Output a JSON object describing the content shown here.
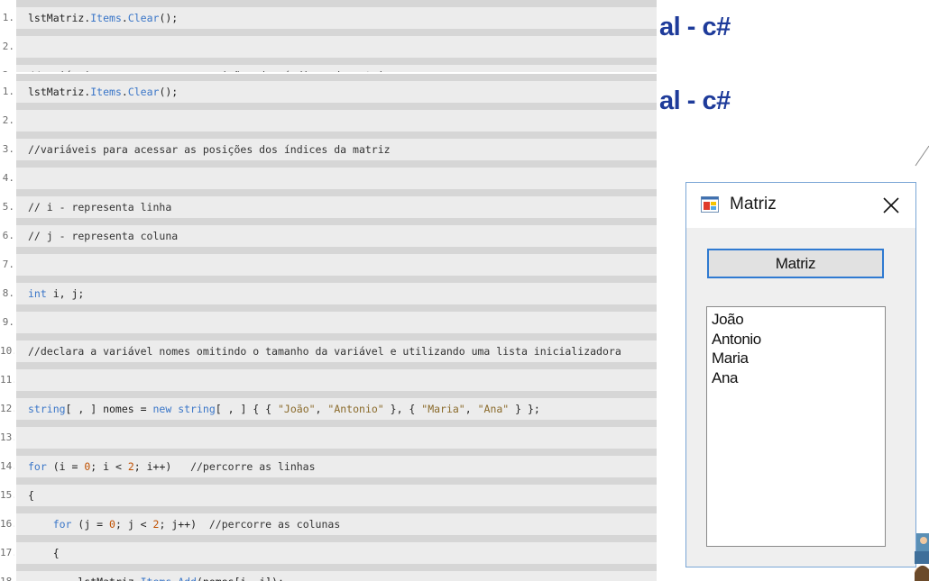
{
  "slide": {
    "title_top": "al - c#",
    "title_main": "al - c#"
  },
  "code_top": {
    "lines": [
      {
        "n": "1.",
        "html": "lstMatriz.<span class=\"kw\">Items</span>.<span class=\"kw\">Clear</span>();"
      },
      {
        "n": "2.",
        "html": ""
      },
      {
        "n": "3.",
        "html": "<span class=\"cm\">//variáveis para acessar as posições dos índices da matriz</span>"
      }
    ]
  },
  "code_main": {
    "lines": [
      {
        "n": "1.",
        "html": "lstMatriz.<span class=\"kw\">Items</span>.<span class=\"kw\">Clear</span>();"
      },
      {
        "n": "2.",
        "html": ""
      },
      {
        "n": "3.",
        "html": "<span class=\"cm\">//variáveis para acessar as posições dos índices da matriz</span>"
      },
      {
        "n": "4.",
        "html": ""
      },
      {
        "n": "5.",
        "html": "<span class=\"cm\">// i - representa linha</span>"
      },
      {
        "n": "6.",
        "html": "<span class=\"cm\">// j - representa coluna</span>"
      },
      {
        "n": "7.",
        "html": ""
      },
      {
        "n": "8.",
        "html": "<span class=\"kw\">int</span> i, j;"
      },
      {
        "n": "9.",
        "html": ""
      },
      {
        "n": "10.",
        "html": "<span class=\"cm\">//declara a variável nomes omitindo o tamanho da variável e utilizando uma lista inicializadora</span>"
      },
      {
        "n": "11.",
        "html": ""
      },
      {
        "n": "12.",
        "html": "<span class=\"kw\">string</span>[ , ] nomes = <span class=\"kw\">new</span> <span class=\"kw\">string</span>[ , ] { { <span class=\"str\">\"João\"</span>, <span class=\"str\">\"Antonio\"</span> }, { <span class=\"str\">\"Maria\"</span>, <span class=\"str\">\"Ana\"</span> } };"
      },
      {
        "n": "13.",
        "html": ""
      },
      {
        "n": "14.",
        "html": "<span class=\"kw\">for</span> (i = <span class=\"num\">0</span>; i &lt; <span class=\"num\">2</span>; i++)   <span class=\"cm\">//percorre as linhas</span>"
      },
      {
        "n": "15.",
        "html": "{"
      },
      {
        "n": "16.",
        "html": "    <span class=\"kw\">for</span> (j = <span class=\"num\">0</span>; j &lt; <span class=\"num\">2</span>; j++)  <span class=\"cm\">//percorre as colunas</span>"
      },
      {
        "n": "17.",
        "html": "    {"
      },
      {
        "n": "18.",
        "html": "        lstMatriz.<span class=\"kw\">Items</span>.<span class=\"kw\">Add</span>(nomes[i, j]);"
      }
    ]
  },
  "form": {
    "title": "Matriz",
    "button_label": "Matriz",
    "list_items": [
      "João",
      "Antonio",
      "Maria",
      "Ana"
    ]
  },
  "colors": {
    "title_blue": "#1e3b9a",
    "keyword_blue": "#3a76c8",
    "button_border": "#2f7ad1"
  },
  "icons": {
    "app": "windows-form-app-icon",
    "close": "close-icon"
  }
}
